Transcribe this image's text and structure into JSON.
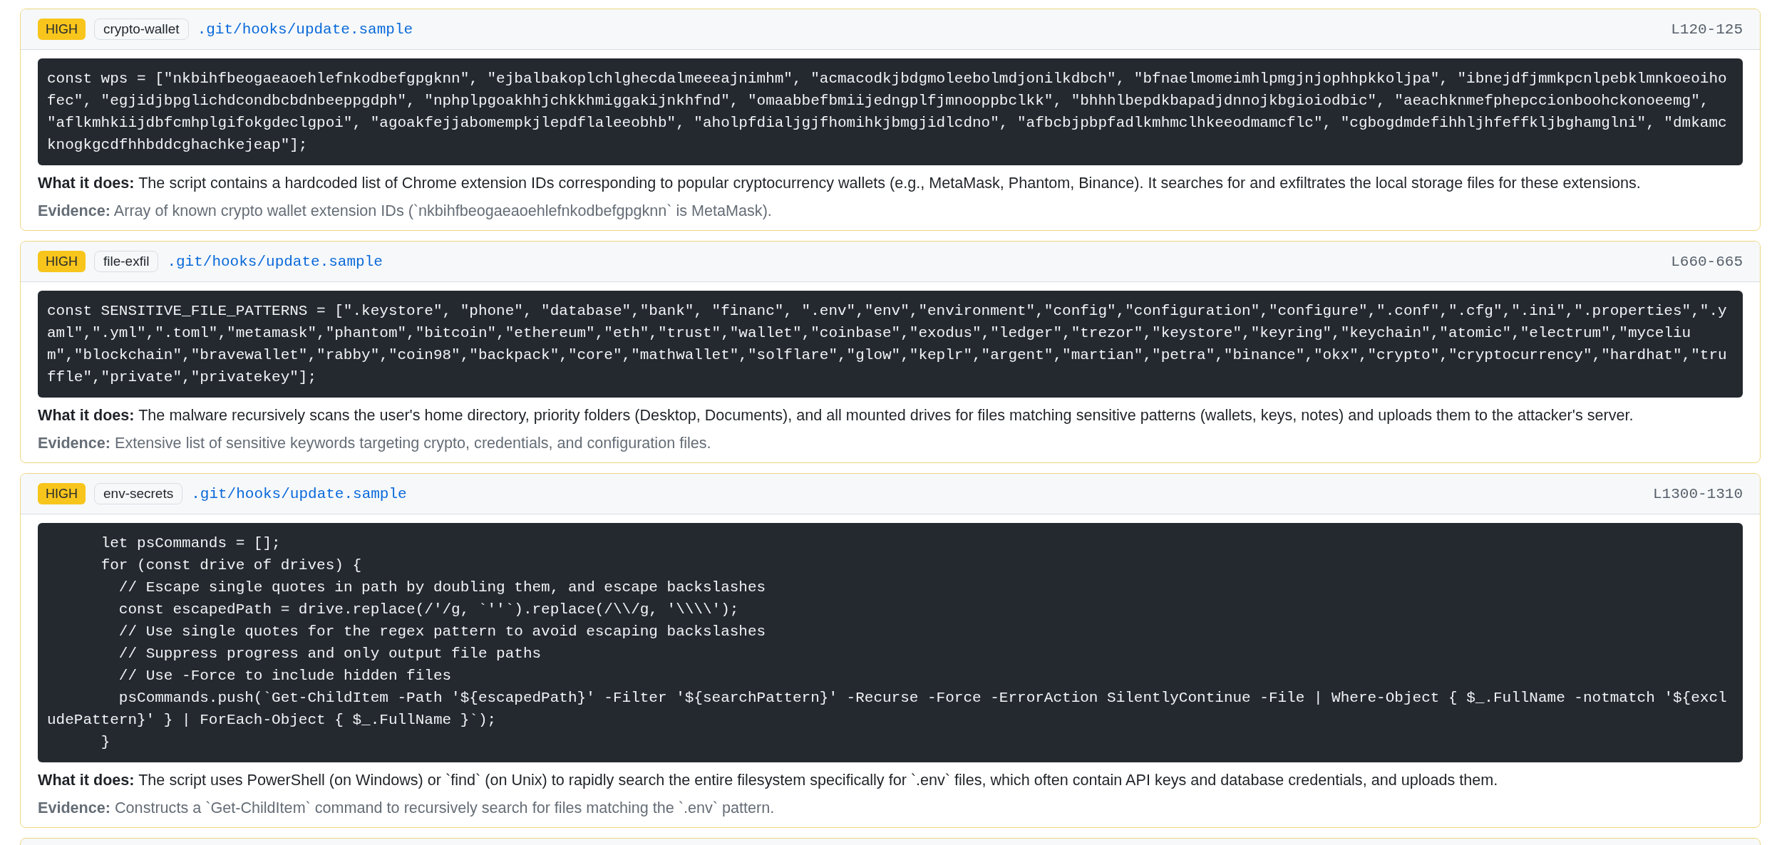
{
  "findings": [
    {
      "severity": "HIGH",
      "category": "crypto-wallet",
      "file": ".git/hooks/update.sample",
      "lines": "L120-125",
      "code": [
        "const wps = [\"nkbihfbeogaeaoehlefnkodbefgpgknn\", \"ejbalbakoplchlghecdalmeeeajnimhm\", \"acmacodkjbdgmoleebolmdjonilkdbch\", \"bfnaelmomeimhlpmgjnjophhpkkoljpa\", \"ibnejdfjmmkpcnlpebklmnkoeoihofec\", \"egjidjbpglichdcondbcbdnbeeppgdph\", \"nphplpgoakhhjchkkhmiggakijnkhfnd\", \"omaabbefbmiijedngplfjmnooppbclkk\", \"bhhhlbepdkbapadjdnnojkbgioiodbic\", \"aeachknmefphepccionboohckonoeemg\", \"aflkmhkiijdbfcmhplgifokgdeclgpoi\", \"agoakfejjabomempkjlepdflaleeobhb\", \"aholpfdialjgjfhomihkjbmgjidlcdno\", \"afbcbjpbpfadlkmhmclhkeeodmamcflc\", \"cgbogdmdefihhljhfeffkljbghamglni\", \"dmkamcknogkgcdfhhbddcghachkejeap\"];"
      ],
      "description": "**What it does:** The script contains a hardcoded list of Chrome extension IDs corresponding to popular cryptocurrency wallets (e.g., MetaMask, Phantom, Binance). It searches for and exfiltrates the local storage files for these extensions.",
      "evidence": "**Evidence:** Array of known crypto wallet extension IDs (`nkbihfbeogaeaoehlefnkodbefgpgknn` is MetaMask)."
    },
    {
      "severity": "HIGH",
      "category": "file-exfil",
      "file": ".git/hooks/update.sample",
      "lines": "L660-665",
      "code": [
        "const SENSITIVE_FILE_PATTERNS = [\".keystore\", \"phone\", \"database\",\"bank\", \"financ\", \".env\",\"env\",\"environment\",\"config\",\"configuration\",\"configure\",\".conf\",\".cfg\",\".ini\",\".properties\",\".yaml\",\".yml\",\".toml\",\"metamask\",\"phantom\",\"bitcoin\",\"ethereum\",\"eth\",\"trust\",\"wallet\",\"coinbase\",\"exodus\",\"ledger\",\"trezor\",\"keystore\",\"keyring\",\"keychain\",\"atomic\",\"electrum\",\"mycelium\",\"blockchain\",\"bravewallet\",\"rabby\",\"coin98\",\"backpack\",\"core\",\"mathwallet\",\"solflare\",\"glow\",\"keplr\",\"argent\",\"martian\",\"petra\",\"binance\",\"okx\",\"crypto\",\"cryptocurrency\",\"hardhat\",\"truffle\",\"private\",\"privatekey\"];"
      ],
      "description": "**What it does:** The malware recursively scans the user's home directory, priority folders (Desktop, Documents), and all mounted drives for files matching sensitive patterns (wallets, keys, notes) and uploads them to the attacker's server.",
      "evidence": "**Evidence:** Extensive list of sensitive keywords targeting crypto, credentials, and configuration files."
    },
    {
      "severity": "HIGH",
      "category": "env-secrets",
      "file": ".git/hooks/update.sample",
      "lines": "L1300-1310",
      "code": [
        "      let psCommands = [];",
        "      for (const drive of drives) {",
        "        // Escape single quotes in path by doubling them, and escape backslashes",
        "        const escapedPath = drive.replace(/'/g, `''`).replace(/\\\\/g, '\\\\\\\\');",
        "        // Use single quotes for the regex pattern to avoid escaping backslashes",
        "        // Suppress progress and only output file paths",
        "        // Use -Force to include hidden files",
        "        psCommands.push(`Get-ChildItem -Path '${escapedPath}' -Filter '${searchPattern}' -Recurse -Force -ErrorAction SilentlyContinue -File | Where-Object { $_.FullName -notmatch '${excludePattern}' } | ForEach-Object { $_.FullName }`);",
        "      }"
      ],
      "description": "**What it does:** The script uses PowerShell (on Windows) or `find` (on Unix) to rapidly search the entire filesystem specifically for `.env` files, which often contain API keys and database credentials, and uploads them.",
      "evidence": "**Evidence:** Constructs a `Get-ChildItem` command to recursively search for files matching the `.env` pattern."
    }
  ]
}
